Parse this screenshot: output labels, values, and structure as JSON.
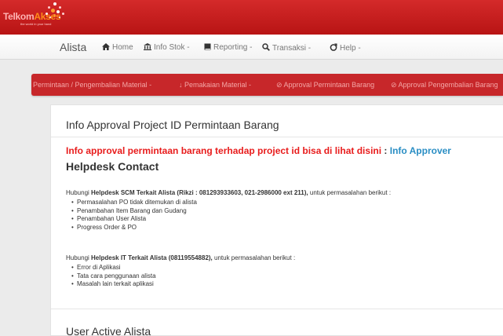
{
  "logo": {
    "part1": "Telkom",
    "part2": "Akses",
    "tagline": "the world in your hand"
  },
  "navbar": {
    "brand": "Alista",
    "items": [
      {
        "label": "Home",
        "icon": "home-icon"
      },
      {
        "label": "Info Stok -",
        "icon": "bank-icon"
      },
      {
        "label": "Reporting -",
        "icon": "book-icon"
      },
      {
        "label": "Transaksi -",
        "icon": "search-icon"
      },
      {
        "label": "Help -",
        "icon": "help-icon"
      }
    ]
  },
  "subnav": {
    "items": [
      {
        "label": "Permintaan / Pengembalian Material -"
      },
      {
        "label": "↓ Pemakaian Material -"
      },
      {
        "label": "⊘ Approval Permintaan Barang"
      },
      {
        "label": "⊘ Approval Pengembalian Barang"
      }
    ]
  },
  "panel": {
    "title": "Info Approval Project ID Permintaan Barang",
    "info_text": "Info approval permintaan barang terhadap project id bisa di lihat disini",
    "info_sep": " : ",
    "info_link": "Info Approver",
    "helpdesk_heading": "Helpdesk Contact",
    "scm": {
      "prefix": "Hubungi ",
      "bold": "Helpdesk SCM Terkait Alista (Rikzi : 081293933603, 021-2986000 ext 211),",
      "suffix": " untuk permasalahan berikut :",
      "items": [
        "Permasalahan PO tidak ditemukan di alista",
        "Penambahan Item Barang dan Gudang",
        "Penambahan User Alista",
        "Progress Order & PO"
      ]
    },
    "it": {
      "prefix": "Hubungi ",
      "bold": "Helpdesk IT Terkait Alista (08119554882),",
      "suffix": " untuk permasalahan berikut :",
      "items": [
        "Error di Aplikasi",
        "Tata cara penggunaan alista",
        "Masalah lain terkait aplikasi"
      ]
    },
    "user_heading": "User Active Alista"
  }
}
